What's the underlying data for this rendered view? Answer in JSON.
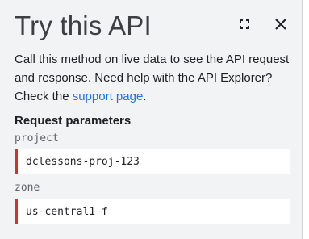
{
  "panel": {
    "title": "Try this API",
    "description_text": "Call this method on live data to see the API request and response. Need help with the API Explorer? Check the ",
    "description_link": "support page",
    "description_end": ".",
    "fullscreen_icon": "fullscreen-icon",
    "close_icon": "close-icon"
  },
  "request_parameters": {
    "title": "Request parameters",
    "params": [
      {
        "label": "project",
        "value": "dclessons-proj-123"
      },
      {
        "label": "zone",
        "value": "us-central1-f"
      }
    ]
  },
  "colors": {
    "link": "#1a73e8",
    "required_marker": "#d93025",
    "panel_background": "#f1f3f4"
  }
}
